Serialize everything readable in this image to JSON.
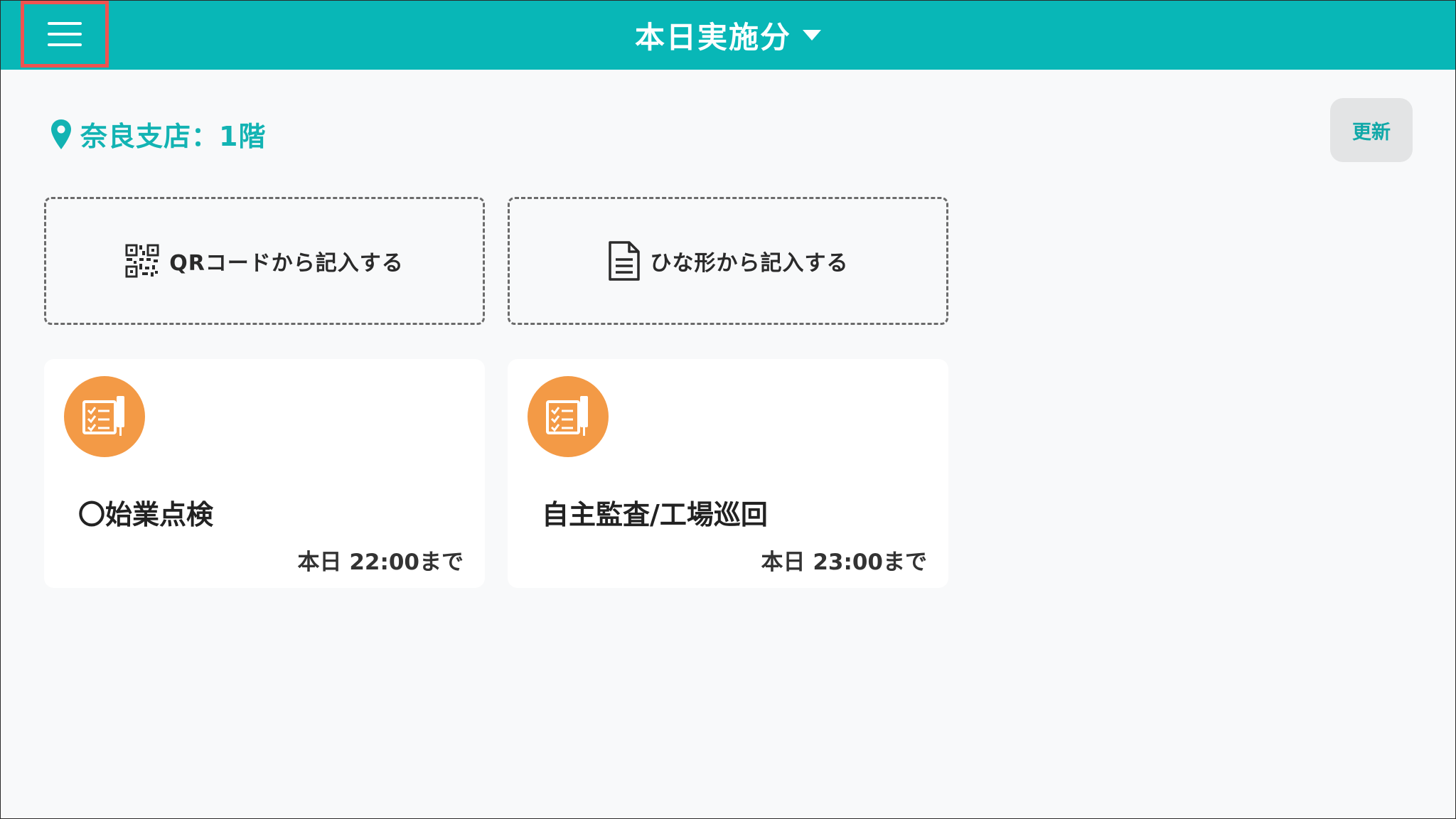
{
  "header": {
    "title": "本日実施分",
    "menu_icon": "hamburger-menu-icon",
    "dropdown_icon": "caret-down-icon",
    "background_color": "#08b7b7",
    "highlight_color": "#ef5350"
  },
  "location": {
    "icon": "map-pin-icon",
    "text": "奈良支店：1階",
    "color": "#13b3b3"
  },
  "refresh_button": {
    "label": "更新"
  },
  "actions": [
    {
      "icon": "qr-code-icon",
      "label": "QRコードから記入する"
    },
    {
      "icon": "document-icon",
      "label": "ひな形から記入する"
    }
  ],
  "tasks": [
    {
      "icon": "checklist-icon",
      "title": "〇始業点検",
      "deadline": "本日 22:00まで"
    },
    {
      "icon": "checklist-icon",
      "title": "自主監査/工場巡回",
      "deadline": "本日 23:00まで"
    }
  ],
  "colors": {
    "task_icon_bg": "#f39a46",
    "background": "#f8f9fa"
  }
}
